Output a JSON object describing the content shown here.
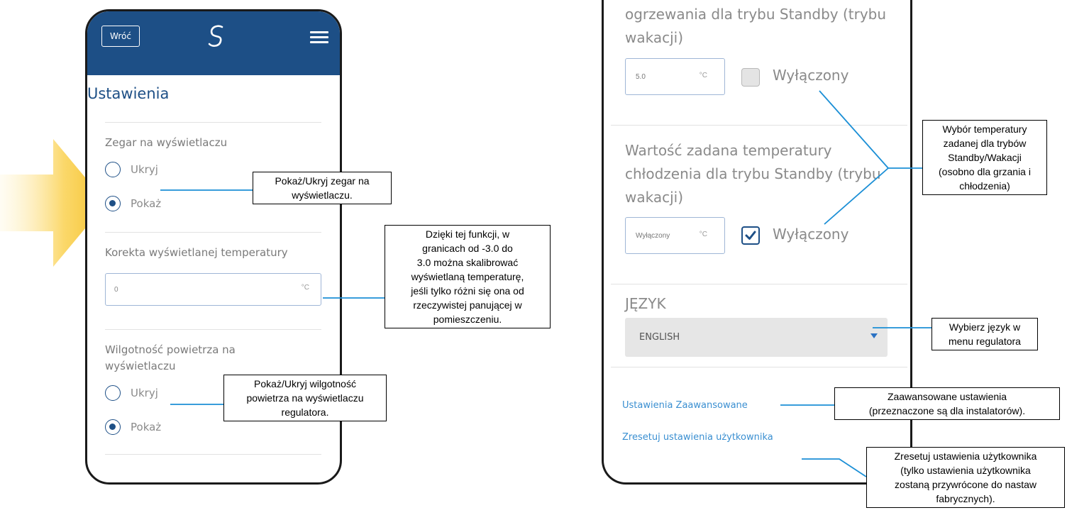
{
  "left_phone": {
    "back_label": "Wróć",
    "title": "Ustawienia",
    "clock_section": {
      "label": "Zegar na wyświetlaczu",
      "options": [
        "Ukryj",
        "Pokaż"
      ],
      "selected": "Pokaż"
    },
    "temp_correction": {
      "label": "Korekta wyświetlanej temperatury",
      "value": "0",
      "unit": "°C"
    },
    "humidity_section": {
      "label_line1": "Wilgotność powietrza na",
      "label_line2": "wyświetlaczu",
      "options": [
        "Ukryj",
        "Pokaż"
      ],
      "selected": "Pokaż"
    }
  },
  "right_phone": {
    "heating_label_line1": "ogrzewania dla trybu Standby (trybu",
    "heating_label_line2": "wakacji)",
    "heating_value": "5.0",
    "heating_unit": "°C",
    "heating_off_label": "Wyłączony",
    "heating_off_checked": false,
    "cooling_label_line1": "Wartość zadana temperatury",
    "cooling_label_line2": "chłodzenia dla trybu Standby (trybu",
    "cooling_label_line3": "wakacji)",
    "cooling_value": "Wyłączony",
    "cooling_unit": "°C",
    "cooling_off_label": "Wyłączony",
    "cooling_off_checked": true,
    "language_label": "JĘZYK",
    "language_value": "ENGLISH",
    "advanced_link": "Ustawienia Zaawansowane",
    "reset_link": "Zresetuj ustawienia użytkownika"
  },
  "callouts": {
    "clock": [
      "Pokaż/Ukryj zegar na",
      "wyświetlaczu."
    ],
    "calibration": [
      "Dzięki tej funkcji, w",
      "granicach od -3.0 do",
      "3.0 można skalibrować",
      "wyświetlaną temperaturę,",
      "jeśli tylko różni się ona od",
      "rzeczywistej panującej w",
      "pomieszczeniu."
    ],
    "humidity": [
      "Pokaż/Ukryj wilgotność",
      "powietrza na wyświetlaczu",
      "regulatora."
    ],
    "standby": [
      "Wybór temperatury",
      "zadanej dla trybów",
      "Standby/Wakacji",
      "(osobno dla grzania i",
      "chłodzenia)"
    ],
    "language": [
      "Wybierz język w",
      "menu regulatora"
    ],
    "advanced": [
      "Zaawansowane ustawienia",
      "(przeznaczone są dla instalatorów)."
    ],
    "reset": [
      "Zresetuj ustawienia użytkownika",
      "(tylko ustawienia użytkownika",
      "zostaną przywrócone do nastaw",
      "fabrycznych)."
    ]
  },
  "colors": {
    "brand_blue": "#1d4f86",
    "link_blue": "#3a8fd1",
    "callout_line": "#1b8fd6",
    "arrow_yellow": "#f6c33a"
  }
}
